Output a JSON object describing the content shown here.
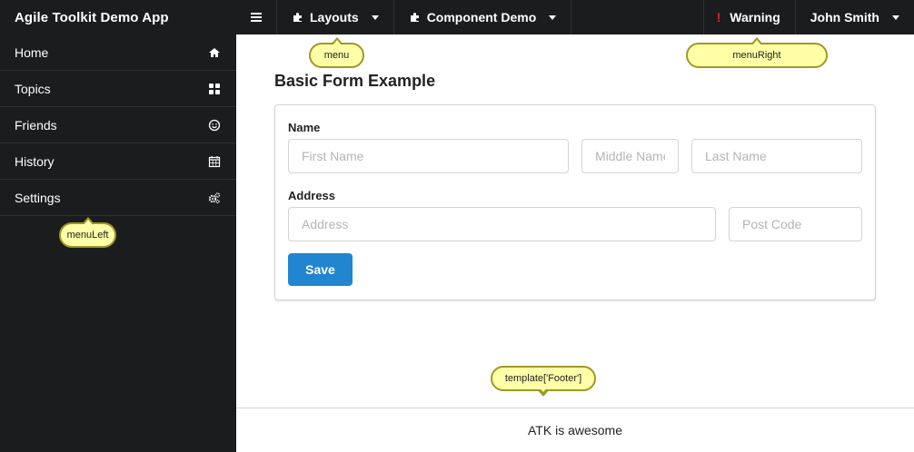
{
  "app": {
    "title": "Agile Toolkit Demo App"
  },
  "topbar": {
    "menu_icon": "hamburger-icon",
    "layouts_label": "Layouts",
    "component_demo_label": "Component Demo",
    "warning_label": "Warning",
    "warning_mark": "!",
    "user_label": "John Smith",
    "puzzle_icon": "puzzle-icon"
  },
  "sidebar": {
    "items": [
      {
        "label": "Home",
        "icon": "home-icon"
      },
      {
        "label": "Topics",
        "icon": "grid-icon"
      },
      {
        "label": "Friends",
        "icon": "smile-icon"
      },
      {
        "label": "History",
        "icon": "calendar-icon"
      },
      {
        "label": "Settings",
        "icon": "gears-icon"
      }
    ]
  },
  "tooltips": {
    "menu": "menu",
    "menu_right": "menuRight",
    "menu_left": "menuLeft",
    "footer": "template['Footer']"
  },
  "form": {
    "title": "Basic Form Example",
    "name_label": "Name",
    "first_name_placeholder": "First Name",
    "middle_name_placeholder": "Middle Name",
    "last_name_placeholder": "Last Name",
    "address_label": "Address",
    "address_placeholder": "Address",
    "post_code_placeholder": "Post Code",
    "save_label": "Save"
  },
  "footer": {
    "text": "ATK is awesome"
  },
  "colors": {
    "dark_bg": "#1b1c1d",
    "primary": "#2185d0",
    "warning": "#db2828",
    "tooltip_bg": "#ffffa8",
    "tooltip_border": "#9c9a25"
  }
}
